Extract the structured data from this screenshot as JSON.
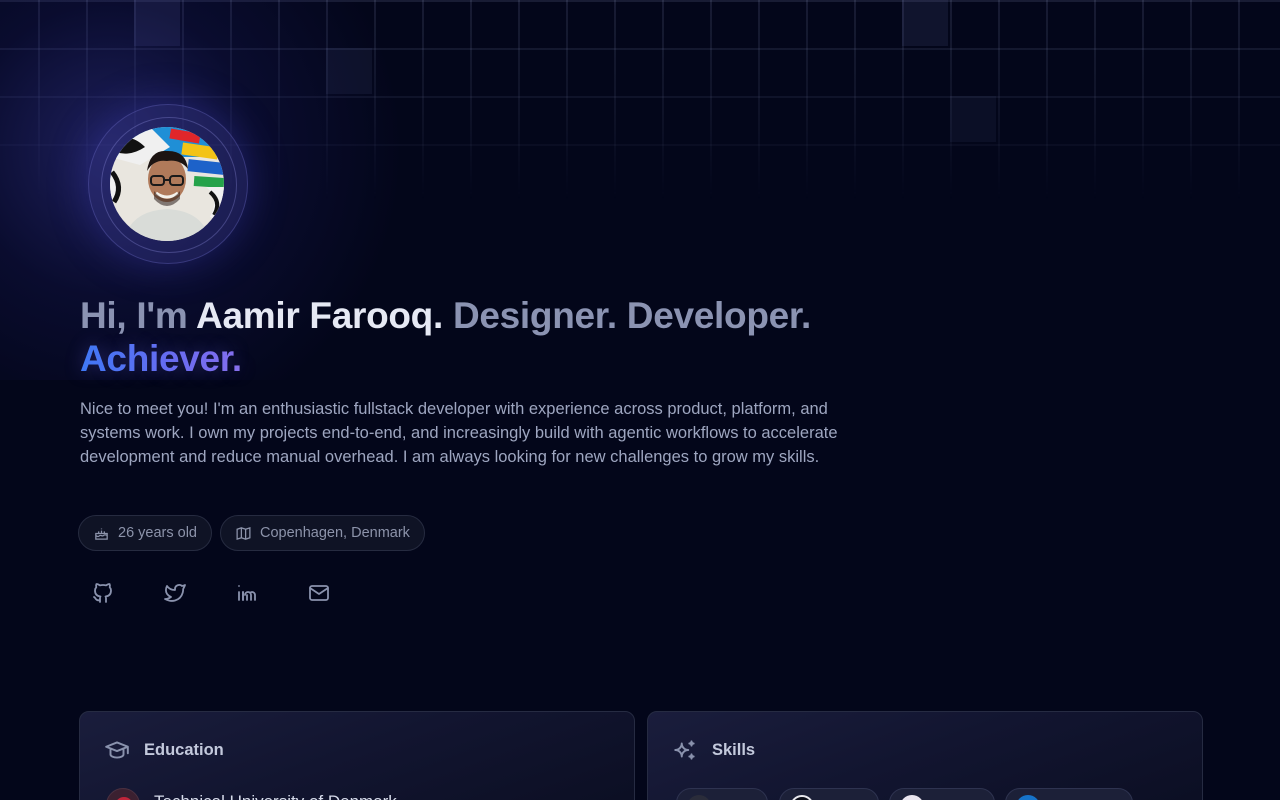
{
  "profile": {
    "greeting": "Hi, I'm",
    "name": "Aamir Farooq.",
    "roles": "Designer. Developer.",
    "highlight": "Achiever.",
    "bio": "Nice to meet you! I'm an enthusiastic fullstack developer with experience across product, platform, and systems work. I own my projects end-to-end, and increasingly build with agentic workflows to accelerate development and reduce manual overhead. I am always looking for new challenges to grow my skills.",
    "avatar_alt": "Profile photo"
  },
  "chips": [
    {
      "icon": "cake-icon",
      "label": "26 years old"
    },
    {
      "icon": "map-icon",
      "label": "Copenhagen, Denmark"
    }
  ],
  "socials": [
    {
      "icon": "github-icon"
    },
    {
      "icon": "twitter-icon"
    },
    {
      "icon": "linkedin-icon"
    },
    {
      "icon": "mail-icon"
    }
  ],
  "education": {
    "title": "Education",
    "icon": "graduation-cap-icon",
    "first_item": "Technical University of Denmark"
  },
  "skills": {
    "title": "Skills",
    "icon": "sparkles-icon"
  },
  "colors": {
    "background": "#03061a",
    "accent_blue": "#3b7bf6",
    "accent_violet": "#8a72ee",
    "muted_text": "#8b93b2"
  }
}
